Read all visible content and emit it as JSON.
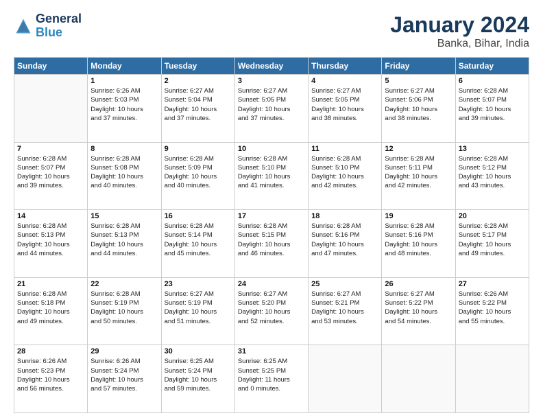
{
  "header": {
    "logo_line1": "General",
    "logo_line2": "Blue",
    "title": "January 2024",
    "subtitle": "Banka, Bihar, India"
  },
  "weekdays": [
    "Sunday",
    "Monday",
    "Tuesday",
    "Wednesday",
    "Thursday",
    "Friday",
    "Saturday"
  ],
  "weeks": [
    [
      {
        "day": "",
        "info": ""
      },
      {
        "day": "1",
        "info": "Sunrise: 6:26 AM\nSunset: 5:03 PM\nDaylight: 10 hours\nand 37 minutes."
      },
      {
        "day": "2",
        "info": "Sunrise: 6:27 AM\nSunset: 5:04 PM\nDaylight: 10 hours\nand 37 minutes."
      },
      {
        "day": "3",
        "info": "Sunrise: 6:27 AM\nSunset: 5:05 PM\nDaylight: 10 hours\nand 37 minutes."
      },
      {
        "day": "4",
        "info": "Sunrise: 6:27 AM\nSunset: 5:05 PM\nDaylight: 10 hours\nand 38 minutes."
      },
      {
        "day": "5",
        "info": "Sunrise: 6:27 AM\nSunset: 5:06 PM\nDaylight: 10 hours\nand 38 minutes."
      },
      {
        "day": "6",
        "info": "Sunrise: 6:28 AM\nSunset: 5:07 PM\nDaylight: 10 hours\nand 39 minutes."
      }
    ],
    [
      {
        "day": "7",
        "info": "Sunrise: 6:28 AM\nSunset: 5:07 PM\nDaylight: 10 hours\nand 39 minutes."
      },
      {
        "day": "8",
        "info": "Sunrise: 6:28 AM\nSunset: 5:08 PM\nDaylight: 10 hours\nand 40 minutes."
      },
      {
        "day": "9",
        "info": "Sunrise: 6:28 AM\nSunset: 5:09 PM\nDaylight: 10 hours\nand 40 minutes."
      },
      {
        "day": "10",
        "info": "Sunrise: 6:28 AM\nSunset: 5:10 PM\nDaylight: 10 hours\nand 41 minutes."
      },
      {
        "day": "11",
        "info": "Sunrise: 6:28 AM\nSunset: 5:10 PM\nDaylight: 10 hours\nand 42 minutes."
      },
      {
        "day": "12",
        "info": "Sunrise: 6:28 AM\nSunset: 5:11 PM\nDaylight: 10 hours\nand 42 minutes."
      },
      {
        "day": "13",
        "info": "Sunrise: 6:28 AM\nSunset: 5:12 PM\nDaylight: 10 hours\nand 43 minutes."
      }
    ],
    [
      {
        "day": "14",
        "info": "Sunrise: 6:28 AM\nSunset: 5:13 PM\nDaylight: 10 hours\nand 44 minutes."
      },
      {
        "day": "15",
        "info": "Sunrise: 6:28 AM\nSunset: 5:13 PM\nDaylight: 10 hours\nand 44 minutes."
      },
      {
        "day": "16",
        "info": "Sunrise: 6:28 AM\nSunset: 5:14 PM\nDaylight: 10 hours\nand 45 minutes."
      },
      {
        "day": "17",
        "info": "Sunrise: 6:28 AM\nSunset: 5:15 PM\nDaylight: 10 hours\nand 46 minutes."
      },
      {
        "day": "18",
        "info": "Sunrise: 6:28 AM\nSunset: 5:16 PM\nDaylight: 10 hours\nand 47 minutes."
      },
      {
        "day": "19",
        "info": "Sunrise: 6:28 AM\nSunset: 5:16 PM\nDaylight: 10 hours\nand 48 minutes."
      },
      {
        "day": "20",
        "info": "Sunrise: 6:28 AM\nSunset: 5:17 PM\nDaylight: 10 hours\nand 49 minutes."
      }
    ],
    [
      {
        "day": "21",
        "info": "Sunrise: 6:28 AM\nSunset: 5:18 PM\nDaylight: 10 hours\nand 49 minutes."
      },
      {
        "day": "22",
        "info": "Sunrise: 6:28 AM\nSunset: 5:19 PM\nDaylight: 10 hours\nand 50 minutes."
      },
      {
        "day": "23",
        "info": "Sunrise: 6:27 AM\nSunset: 5:19 PM\nDaylight: 10 hours\nand 51 minutes."
      },
      {
        "day": "24",
        "info": "Sunrise: 6:27 AM\nSunset: 5:20 PM\nDaylight: 10 hours\nand 52 minutes."
      },
      {
        "day": "25",
        "info": "Sunrise: 6:27 AM\nSunset: 5:21 PM\nDaylight: 10 hours\nand 53 minutes."
      },
      {
        "day": "26",
        "info": "Sunrise: 6:27 AM\nSunset: 5:22 PM\nDaylight: 10 hours\nand 54 minutes."
      },
      {
        "day": "27",
        "info": "Sunrise: 6:26 AM\nSunset: 5:22 PM\nDaylight: 10 hours\nand 55 minutes."
      }
    ],
    [
      {
        "day": "28",
        "info": "Sunrise: 6:26 AM\nSunset: 5:23 PM\nDaylight: 10 hours\nand 56 minutes."
      },
      {
        "day": "29",
        "info": "Sunrise: 6:26 AM\nSunset: 5:24 PM\nDaylight: 10 hours\nand 57 minutes."
      },
      {
        "day": "30",
        "info": "Sunrise: 6:25 AM\nSunset: 5:24 PM\nDaylight: 10 hours\nand 59 minutes."
      },
      {
        "day": "31",
        "info": "Sunrise: 6:25 AM\nSunset: 5:25 PM\nDaylight: 11 hours\nand 0 minutes."
      },
      {
        "day": "",
        "info": ""
      },
      {
        "day": "",
        "info": ""
      },
      {
        "day": "",
        "info": ""
      }
    ]
  ]
}
